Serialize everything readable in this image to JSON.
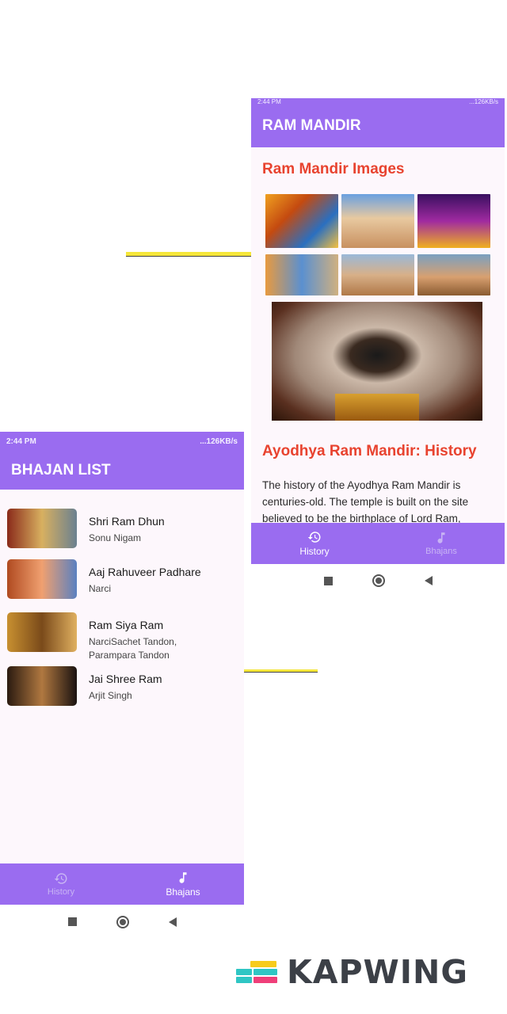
{
  "right_phone": {
    "status": {
      "time": "2:44 PM",
      "indicators": "...126KB/s"
    },
    "appbar_title": "RAM MANDIR",
    "images_title": "Ram Mandir Images",
    "history_title": "Ayodhya Ram Mandir: History",
    "history_text": "The history of the Ayodhya Ram Mandir is centuries-old. The temple is built on the site believed to be the birthplace of Lord Ram,",
    "nav": {
      "history": "History",
      "bhajans": "Bhajans"
    }
  },
  "left_phone": {
    "status": {
      "time": "2:44 PM",
      "indicators": "...126KB/s"
    },
    "appbar_title": "BHAJAN LIST",
    "items": [
      {
        "title": "Shri Ram Dhun",
        "artist": "Sonu Nigam"
      },
      {
        "title": "Aaj Rahuveer Padhare",
        "artist": "Narci"
      },
      {
        "title": "Ram Siya Ram",
        "artist": "NarciSachet Tandon, Parampara Tandon"
      },
      {
        "title": "Jai Shree Ram",
        "artist": "Arjit Singh"
      }
    ],
    "nav": {
      "history": "History",
      "bhajans": "Bhajans"
    }
  },
  "watermark": {
    "brand": "KAPWING"
  },
  "colors": {
    "primary": "#9a6cf0",
    "accent_title": "#e8432f",
    "surface": "#fdf7fc"
  }
}
